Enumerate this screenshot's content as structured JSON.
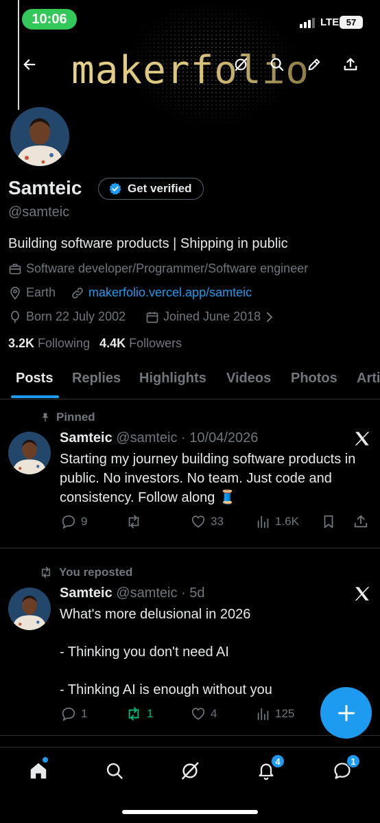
{
  "status_bar": {
    "time": "10:06",
    "network": "LTE",
    "battery": "57"
  },
  "banner": {
    "logo_text": "makerfolio"
  },
  "header_icons": [
    "back-arrow-icon",
    "grok-icon",
    "search-icon",
    "edit-icon",
    "share-icon"
  ],
  "profile": {
    "name": "Samteic",
    "verify_label": "Get verified",
    "handle": "@samteic",
    "bio": "Building software products | Shipping in public",
    "category": "Software developer/Programmer/Software engineer",
    "location": "Earth",
    "website": "makerfolio.vercel.app/samteic",
    "born": "Born 22 July 2002",
    "joined": "Joined June 2018",
    "following_count": "3.2K",
    "following_label": "Following",
    "followers_count": "4.4K",
    "followers_label": "Followers"
  },
  "tabs": [
    {
      "label": "Posts",
      "active": true
    },
    {
      "label": "Replies"
    },
    {
      "label": "Highlights"
    },
    {
      "label": "Videos"
    },
    {
      "label": "Photos"
    },
    {
      "label": "Arti"
    }
  ],
  "posts": [
    {
      "context": "Pinned",
      "author": "Samteic",
      "meta": "@samteic · 10/04/2026",
      "text": "Starting my journey building software products in public. No investors. No team. Just code and consistency. Follow along 🧵",
      "replies": "9",
      "reposts": "",
      "likes": "33",
      "views": "1.6K"
    },
    {
      "context": "You reposted",
      "author": "Samteic",
      "meta": "@samteic · 5d",
      "line1": "What's more delusional in 2026",
      "line2": "- Thinking you don't need AI",
      "line3": "- Thinking AI is enough without you",
      "replies": "1",
      "reposts": "1",
      "likes": "4",
      "views": "125"
    }
  ],
  "bottom_nav": {
    "notifications_badge": "4",
    "messages_badge": "1"
  },
  "colors": {
    "accent": "#1d9bf0",
    "repost_green": "#00ba7c",
    "status_green": "#34c759"
  }
}
